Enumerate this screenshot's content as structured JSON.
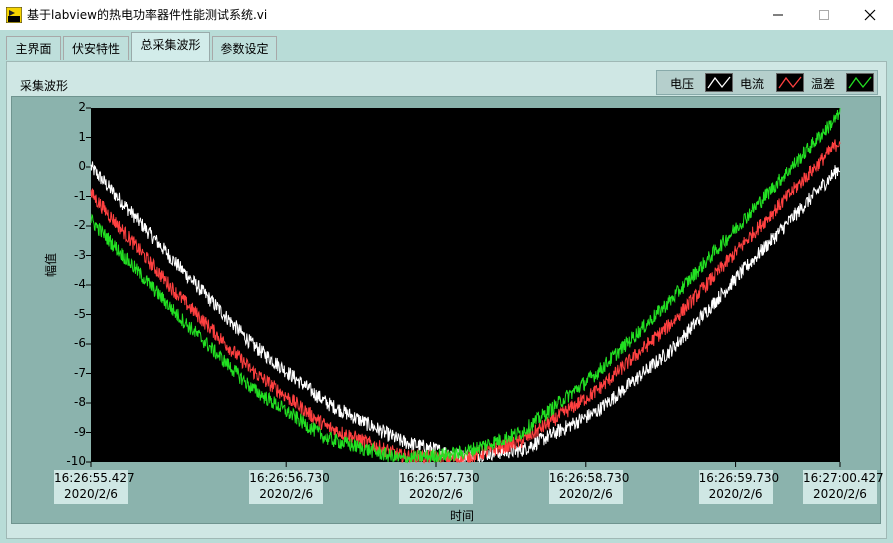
{
  "window": {
    "title": "基于labview的热电功率器件性能测试系统.vi"
  },
  "tabs": [
    {
      "label": "主界面"
    },
    {
      "label": "伏安特性"
    },
    {
      "label": "总采集波形",
      "active": true
    },
    {
      "label": "参数设定"
    }
  ],
  "graph": {
    "label": "采集波形",
    "legend": [
      {
        "name": "电压",
        "color": "#ffffff"
      },
      {
        "name": "电流",
        "color": "#ff4040"
      },
      {
        "name": "温差",
        "color": "#22e022"
      }
    ],
    "plot_background": "#000000",
    "frame_color": "#8bb3ad"
  },
  "chart_data": {
    "type": "line",
    "title": "采集波形",
    "xlabel": "时间",
    "ylabel": "幅值",
    "ylim": [
      -10,
      2
    ],
    "y_ticks": [
      "2",
      "1",
      "0",
      "-1",
      "-2",
      "-3",
      "-4",
      "-5",
      "-6",
      "-7",
      "-8",
      "-9",
      "-10"
    ],
    "x_tick_labels": [
      {
        "time": "16:26:55.427",
        "date": "2020/2/6"
      },
      {
        "time": "16:26:56.730",
        "date": "2020/2/6"
      },
      {
        "time": "16:26:57.730",
        "date": "2020/2/6"
      },
      {
        "time": "16:26:58.730",
        "date": "2020/2/6"
      },
      {
        "time": "16:26:59.730",
        "date": "2020/2/6"
      },
      {
        "time": "16:27:00.427",
        "date": "2020/2/6"
      }
    ],
    "x_tick_seconds": [
      55.427,
      56.73,
      57.73,
      58.73,
      59.73,
      60.427
    ],
    "xlim_seconds": [
      55.427,
      60.427
    ],
    "grid": false,
    "legend_position": "top-right",
    "noise_amplitude": 0.25,
    "series": [
      {
        "name": "电压",
        "color": "#ffffff",
        "x": [
          55.427,
          56.0,
          56.5,
          57.0,
          57.5,
          57.9,
          58.3,
          58.8,
          59.3,
          59.8,
          60.427
        ],
        "y": [
          0.0,
          -3.3,
          -6.0,
          -8.0,
          -9.3,
          -9.8,
          -9.6,
          -8.3,
          -6.2,
          -3.4,
          0.0
        ]
      },
      {
        "name": "电流",
        "color": "#ff4040",
        "x": [
          55.427,
          56.0,
          56.5,
          57.0,
          57.5,
          57.9,
          58.3,
          58.8,
          59.3,
          59.8,
          60.427
        ],
        "y": [
          -0.9,
          -4.3,
          -6.9,
          -8.8,
          -9.8,
          -9.9,
          -9.3,
          -7.6,
          -5.3,
          -2.5,
          0.9
        ]
      },
      {
        "name": "温差",
        "color": "#22e022",
        "x": [
          55.427,
          56.0,
          56.5,
          57.0,
          57.5,
          57.9,
          58.3,
          58.8,
          59.3,
          59.8,
          60.427
        ],
        "y": [
          -1.8,
          -5.0,
          -7.5,
          -9.2,
          -9.9,
          -9.7,
          -9.0,
          -7.0,
          -4.5,
          -1.7,
          1.8
        ]
      }
    ]
  }
}
